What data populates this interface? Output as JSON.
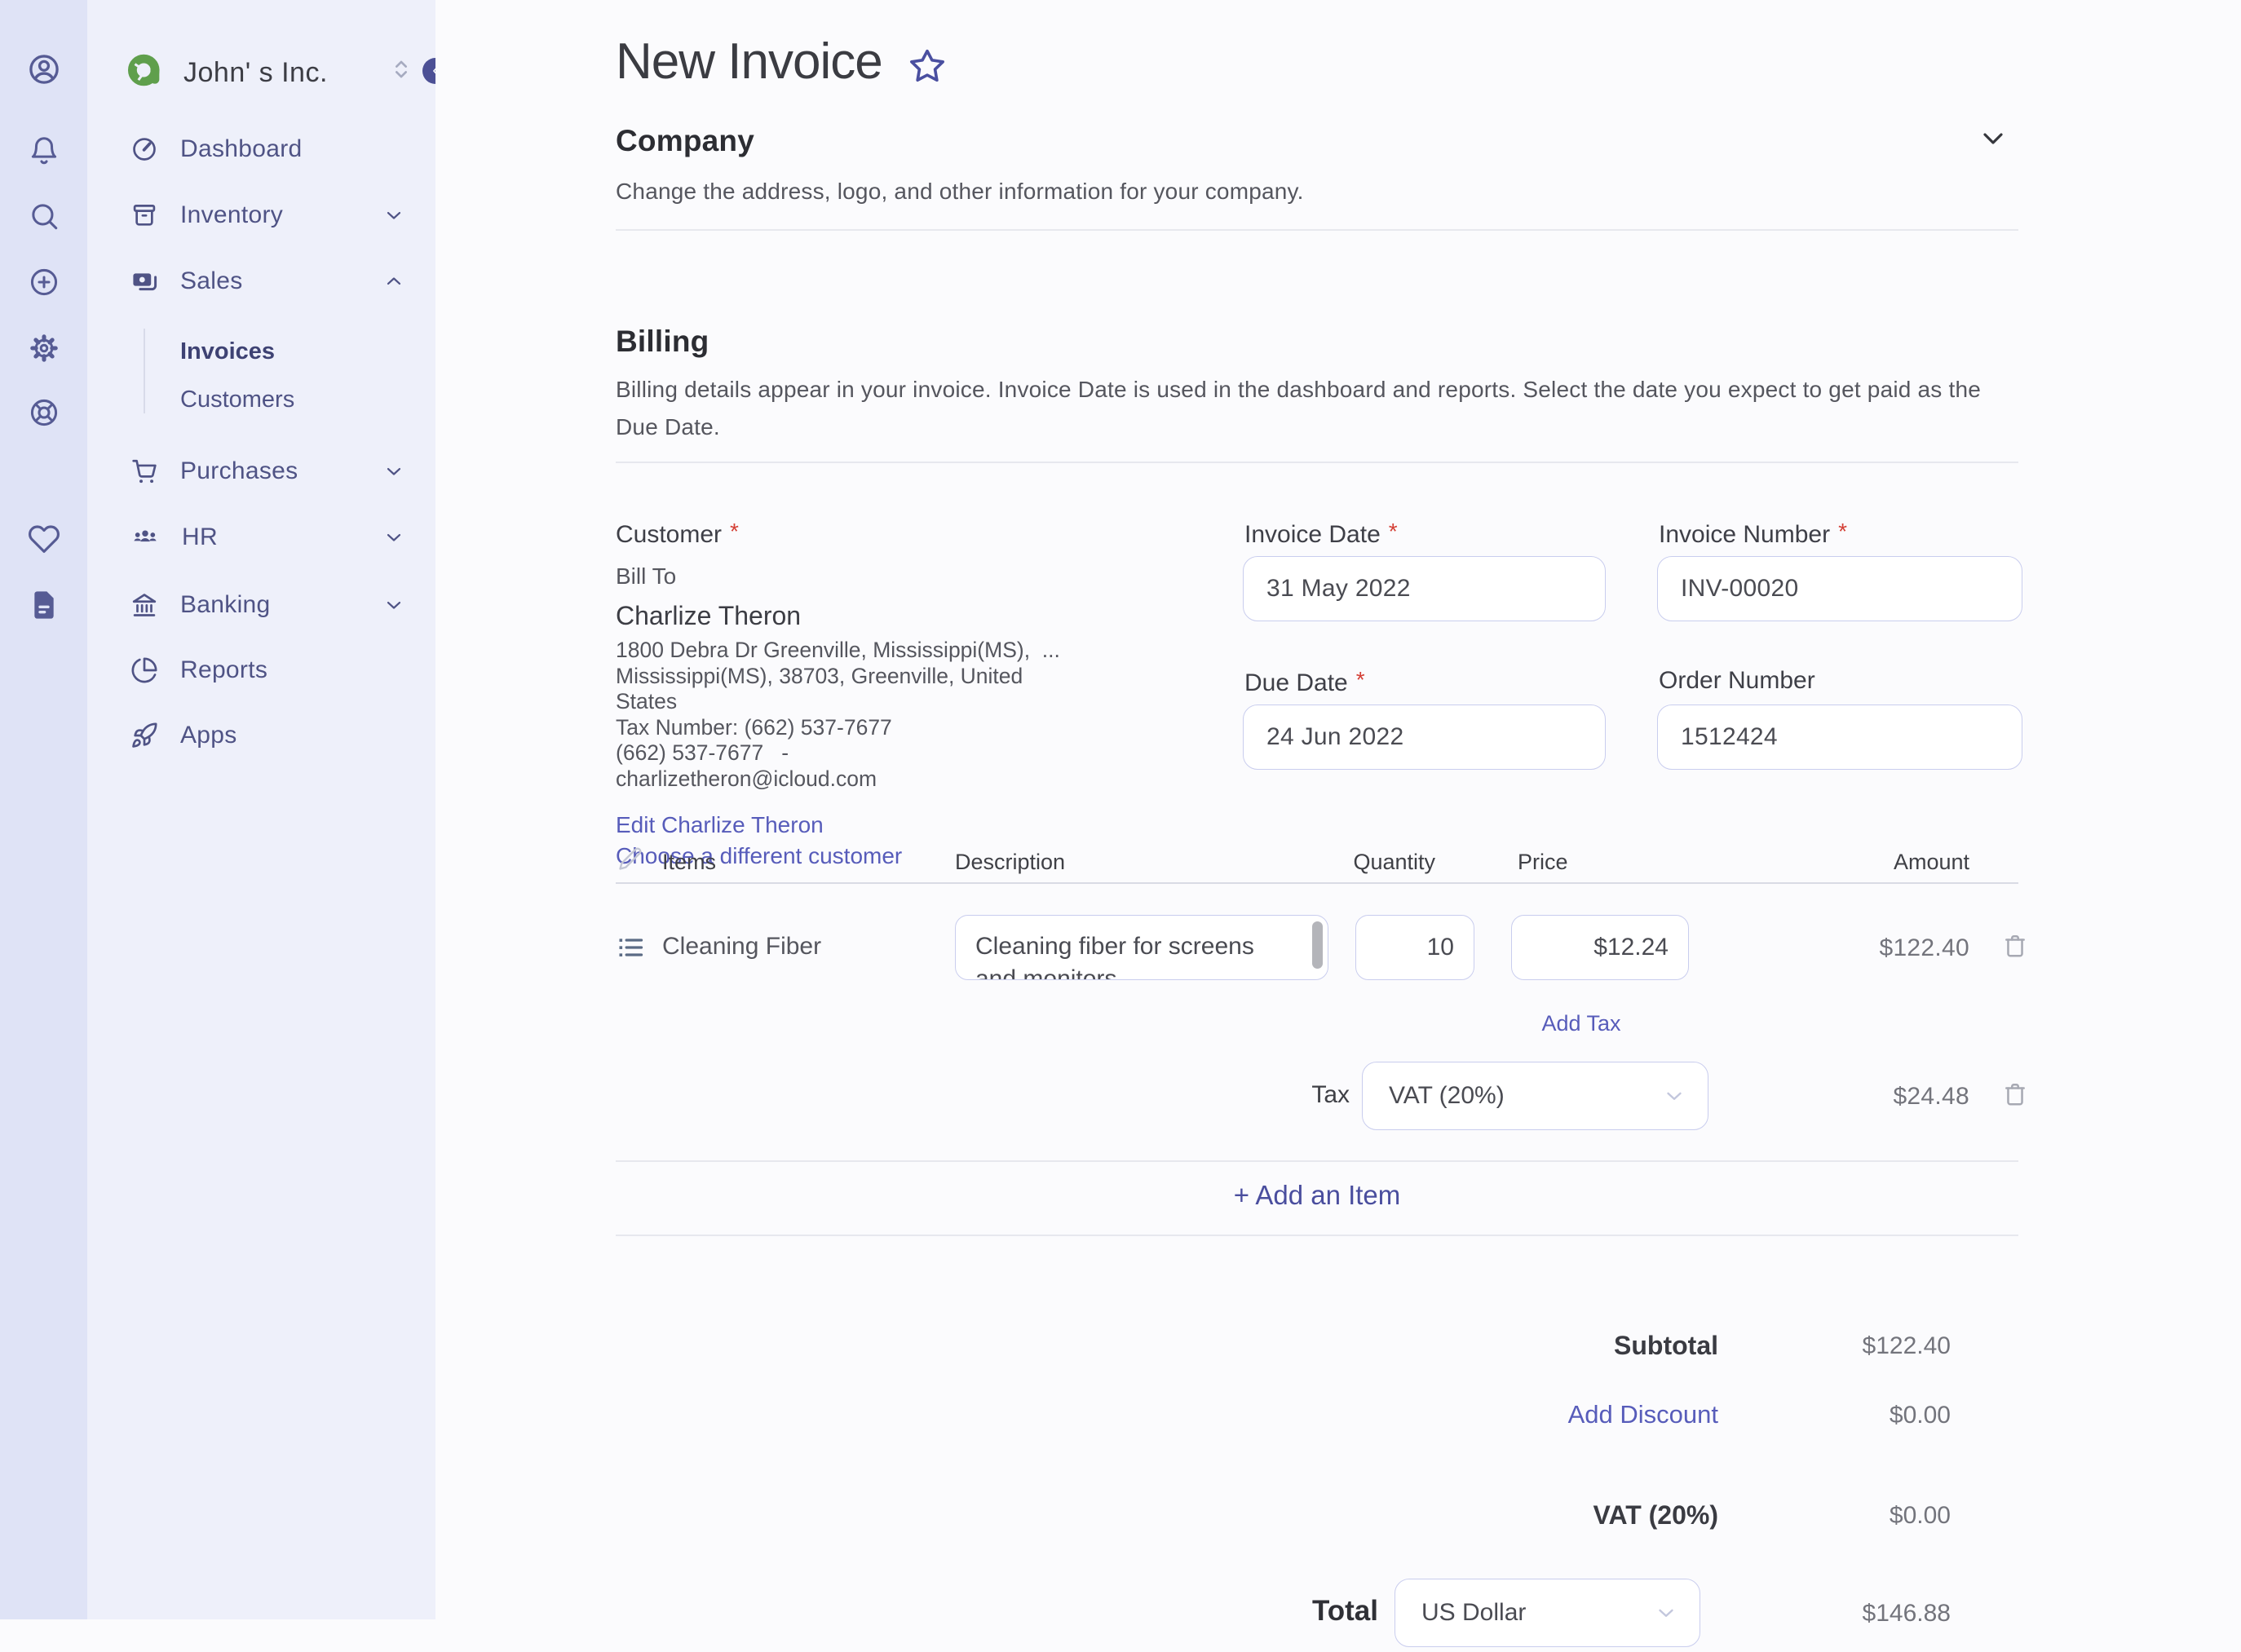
{
  "ui": {
    "required_marker": "*"
  },
  "sidebar": {
    "company": "John' s Inc.",
    "items": [
      {
        "label": "Dashboard"
      },
      {
        "label": "Inventory"
      },
      {
        "label": "Sales"
      },
      {
        "label": "Purchases"
      },
      {
        "label": "HR"
      },
      {
        "label": "Banking"
      },
      {
        "label": "Reports"
      },
      {
        "label": "Apps"
      }
    ],
    "sales_subitems": [
      {
        "label": "Invoices"
      },
      {
        "label": "Customers"
      }
    ]
  },
  "page": {
    "title": "New Invoice"
  },
  "company_section": {
    "title": "Company",
    "description": "Change the address, logo, and other information for your company."
  },
  "billing_section": {
    "title": "Billing",
    "description": "Billing details appear in your invoice. Invoice Date is used in the dashboard and reports. Select the date you expect to get paid as the Due Date."
  },
  "customer": {
    "label": "Customer",
    "bill_to": "Bill To",
    "name": "Charlize Theron",
    "address_line1": "1800 Debra Dr Greenville, Mississippi(MS),  ...",
    "address_line2": "Mississippi(MS), 38703, Greenville, United",
    "address_line3": "States",
    "tax_number": "Tax Number: (662) 537-7677",
    "phone": "(662) 537-7677   -",
    "email": "charlizetheron@icloud.com",
    "edit_link": "Edit Charlize Theron",
    "choose_link": "Choose a different customer"
  },
  "fields": {
    "invoice_date": {
      "label": "Invoice Date",
      "value": "31 May 2022"
    },
    "invoice_number": {
      "label": "Invoice Number",
      "value": "INV-00020"
    },
    "due_date": {
      "label": "Due Date",
      "value": "24 Jun 2022"
    },
    "order_number": {
      "label": "Order Number",
      "value": "1512424"
    }
  },
  "items_table": {
    "headers": {
      "items": "Items",
      "description": "Description",
      "quantity": "Quantity",
      "price": "Price",
      "amount": "Amount"
    },
    "rows": [
      {
        "name": "Cleaning Fiber",
        "description": "Cleaning fiber for screens and monitors",
        "quantity": "10",
        "price": "$12.24",
        "amount": "$122.40"
      }
    ],
    "add_tax_label": "Add Tax",
    "tax_row": {
      "label": "Tax",
      "value": "VAT (20%)",
      "amount": "$24.48"
    },
    "add_item_label": "+ Add an Item"
  },
  "totals": {
    "subtotal_label": "Subtotal",
    "subtotal_value": "$122.40",
    "discount_label": "Add Discount",
    "discount_value": "$0.00",
    "vat_label": "VAT (20%)",
    "vat_value": "$0.00",
    "total_label": "Total",
    "currency": "US Dollar",
    "total_value": "$146.88"
  },
  "colors": {
    "accent_link": "#575cba",
    "accent_dark": "#4a4e9e",
    "sidebar_text": "#4f5385",
    "logo_green": "#5f9f4c",
    "required": "#d43f35"
  }
}
